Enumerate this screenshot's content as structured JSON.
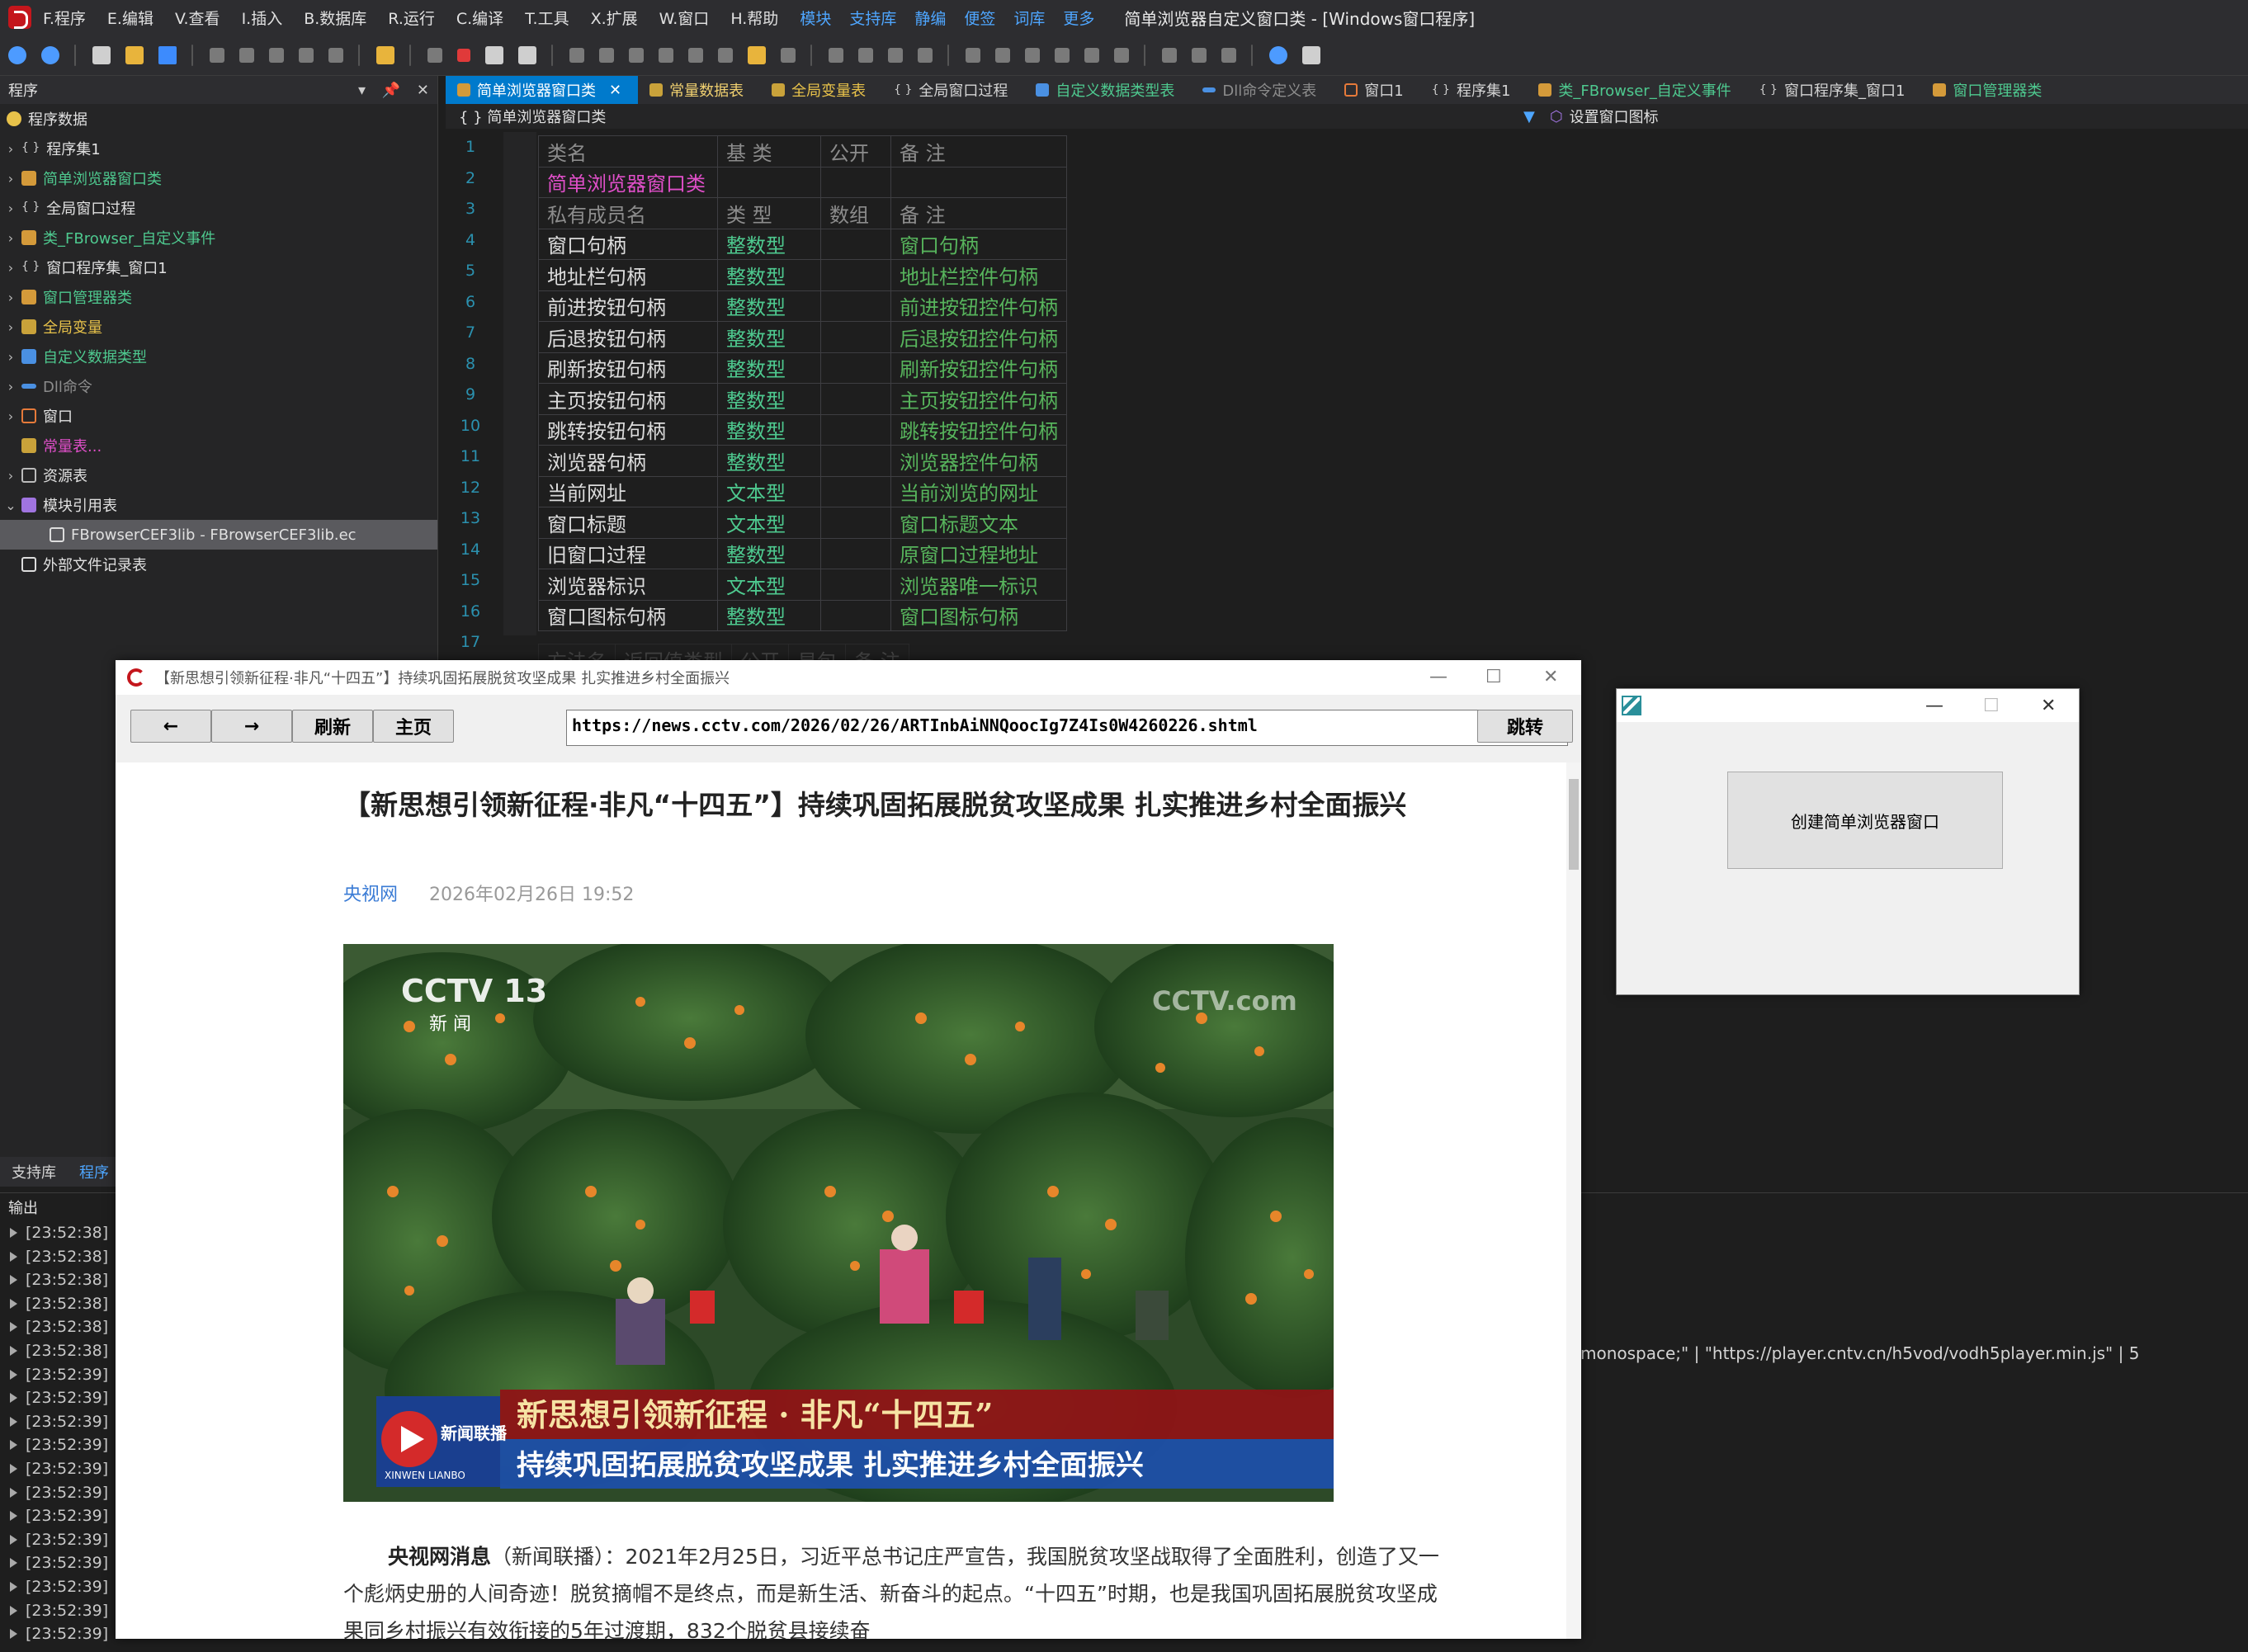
{
  "menubar": {
    "items": [
      "F.程序",
      "E.编辑",
      "V.查看",
      "I.插入",
      "B.数据库",
      "R.运行",
      "C.编译",
      "T.工具",
      "X.扩展",
      "W.窗口",
      "H.帮助"
    ],
    "links": [
      "模块",
      "支持库",
      "静编",
      "便签",
      "词库",
      "更多"
    ],
    "title": "简单浏览器自定义窗口类 - [Windows窗口程序]"
  },
  "left_panel": {
    "header": "程序",
    "header_controls": [
      "▾",
      "📌",
      "✕"
    ],
    "tree": [
      {
        "label": "程序数据",
        "color": "default"
      },
      {
        "label": "程序集1",
        "color": "default"
      },
      {
        "label": "简单浏览器窗口类",
        "color": "green"
      },
      {
        "label": "全局窗口过程",
        "color": "default"
      },
      {
        "label": "类_FBrowser_自定义事件",
        "color": "green"
      },
      {
        "label": "窗口程序集_窗口1",
        "color": "default"
      },
      {
        "label": "窗口管理器类",
        "color": "green"
      },
      {
        "label": "全局变量",
        "color": "gold"
      },
      {
        "label": "自定义数据类型",
        "color": "green"
      },
      {
        "label": "Dll命令",
        "color": "gray"
      },
      {
        "label": "窗口",
        "color": "default"
      },
      {
        "label": "常量表...",
        "color": "pink"
      },
      {
        "label": "资源表",
        "color": "default"
      },
      {
        "label": "模块引用表",
        "color": "default"
      },
      {
        "label": "FBrowserCEF3lib - FBrowserCEF3lib.ec",
        "color": "default"
      },
      {
        "label": "外部文件记录表",
        "color": "default"
      }
    ],
    "bottom_tabs": [
      "支持库",
      "程序"
    ]
  },
  "tabs": [
    {
      "label": "简单浏览器窗口类",
      "active": true
    },
    {
      "label": "常量数据表"
    },
    {
      "label": "全局变量表"
    },
    {
      "label": "全局窗口过程"
    },
    {
      "label": "自定义数据类型表"
    },
    {
      "label": "Dll命令定义表"
    },
    {
      "label": "窗口1"
    },
    {
      "label": "程序集1"
    },
    {
      "label": "类_FBrowser_自定义事件"
    },
    {
      "label": "窗口程序集_窗口1"
    },
    {
      "label": "窗口管理器类"
    }
  ],
  "breadcrumb": {
    "left": "{ } 简单浏览器窗口类",
    "right": "设置窗口图标"
  },
  "code": {
    "line_numbers": [
      "1",
      "2",
      "3",
      "4",
      "5",
      "6",
      "7",
      "8",
      "9",
      "10",
      "11",
      "12",
      "13",
      "14",
      "15",
      "16",
      "17"
    ],
    "class_header": [
      "类名",
      "基 类",
      "公开",
      "备 注"
    ],
    "class_row": [
      "简单浏览器窗口类",
      "",
      "",
      ""
    ],
    "member_header": [
      "私有成员名",
      "类 型",
      "数组",
      "备 注"
    ],
    "members": [
      [
        "窗口句柄",
        "整数型",
        "",
        "窗口句柄"
      ],
      [
        "地址栏句柄",
        "整数型",
        "",
        "地址栏控件句柄"
      ],
      [
        "前进按钮句柄",
        "整数型",
        "",
        "前进按钮控件句柄"
      ],
      [
        "后退按钮句柄",
        "整数型",
        "",
        "后退按钮控件句柄"
      ],
      [
        "刷新按钮句柄",
        "整数型",
        "",
        "刷新按钮控件句柄"
      ],
      [
        "主页按钮句柄",
        "整数型",
        "",
        "主页按钮控件句柄"
      ],
      [
        "跳转按钮句柄",
        "整数型",
        "",
        "跳转按钮控件句柄"
      ],
      [
        "浏览器句柄",
        "整数型",
        "",
        "浏览器控件句柄"
      ],
      [
        "当前网址",
        "文本型",
        "",
        "当前浏览的网址"
      ],
      [
        "窗口标题",
        "文本型",
        "",
        "窗口标题文本"
      ],
      [
        "旧窗口过程",
        "整数型",
        "",
        "原窗口过程地址"
      ],
      [
        "浏览器标识",
        "文本型",
        "",
        "浏览器唯一标识"
      ],
      [
        "窗口图标句柄",
        "整数型",
        "",
        "窗口图标句柄"
      ]
    ],
    "method_header": [
      "方法名",
      "返回值类型",
      "公开",
      "易包",
      "备 注"
    ]
  },
  "output": {
    "header": "输出",
    "lines": [
      "[23:52:38]",
      "[23:52:38]",
      "[23:52:38]",
      "[23:52:38]",
      "[23:52:38]",
      "[23:52:38]",
      "[23:52:39]",
      "[23:52:39]",
      "[23:52:39]",
      "[23:52:39]",
      "[23:52:39]",
      "[23:52:39]",
      "[23:52:39]",
      "[23:52:39]",
      "[23:52:39]",
      "[23:52:39]",
      "[23:52:39]",
      "[23:52:39]"
    ],
    "right_text": "monospace;\"  |  \"https://player.cntv.cn/h5vod/vodh5player.min.js\"  | 5"
  },
  "browser": {
    "title": "【新思想引领新征程·非凡“十四五”】持续巩固拓展脱贫攻坚成果 扎实推进乡村全面振兴",
    "buttons": {
      "back": "←",
      "forward": "→",
      "refresh": "刷新",
      "home": "主页",
      "go": "跳转"
    },
    "url": "https://news.cctv.com/2026/02/26/ARTInbAiNNQoocIg7Z4Is0W4260226.shtml",
    "article": {
      "title": "【新思想引领新征程·非凡“十四五”】持续巩固拓展脱贫攻坚成果 扎实推进乡村全面振兴",
      "source": "央视网",
      "time": "2026年02月26日 19:52",
      "image": {
        "logo_left": "CCTV 13",
        "logo_sub": "新 闻",
        "logo_right": "CCTV.com",
        "caption1": "新思想引领新征程 · 非凡“十四五”",
        "caption2": "持续巩固拓展脱贫攻坚成果 扎实推进乡村全面振兴",
        "badge": "新闻联播",
        "badge_en": "XINWEN LIANBO"
      },
      "body_lead": "央视网消息",
      "body": "（新闻联播）：2021年2月25日，习近平总书记庄严宣告，我国脱贫攻坚战取得了全面胜利，创造了又一个彪炳史册的人间奇迹！脱贫摘帽不是终点，而是新生活、新奋斗的起点。“十四五”时期，也是我国巩固拓展脱贫攻坚成果同乡村振兴有效衔接的5年过渡期，832个脱贫县接续奋"
    }
  },
  "small_window": {
    "button": "创建简单浏览器窗口"
  },
  "colors": {
    "accent": "#007acc",
    "ide_bg": "#1e1e1e",
    "green_text": "#4ec98f",
    "comment_green": "#57b45c",
    "pink": "#e04fc9"
  }
}
